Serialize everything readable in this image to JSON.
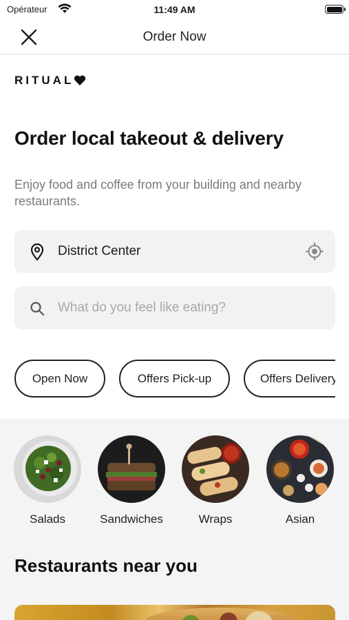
{
  "status_bar": {
    "carrier": "Opérateur",
    "time": "11:49 AM"
  },
  "nav": {
    "title": "Order Now",
    "close_icon": "close-icon"
  },
  "brand": {
    "name": "RITUAL"
  },
  "hero": {
    "title": "Order local takeout & delivery",
    "subtitle": "Enjoy food and coffee from your building and nearby restaurants."
  },
  "location": {
    "value": "District Center",
    "leading_icon": "map-pin-icon",
    "trailing_icon": "locate-icon"
  },
  "search": {
    "placeholder": "What do you feel like eating?",
    "icon": "search-icon"
  },
  "filters": [
    {
      "label": "Open Now"
    },
    {
      "label": "Offers Pick-up"
    },
    {
      "label": "Offers Delivery"
    }
  ],
  "categories": [
    {
      "label": "Salads"
    },
    {
      "label": "Sandwiches"
    },
    {
      "label": "Wraps"
    },
    {
      "label": "Asian"
    }
  ],
  "restaurants_section": {
    "title": "Restaurants near you"
  },
  "colors": {
    "accent": "#111111",
    "field_bg": "#f2f2f2",
    "placeholder": "#a8a8a8",
    "subtitle": "#7a7a7a"
  }
}
